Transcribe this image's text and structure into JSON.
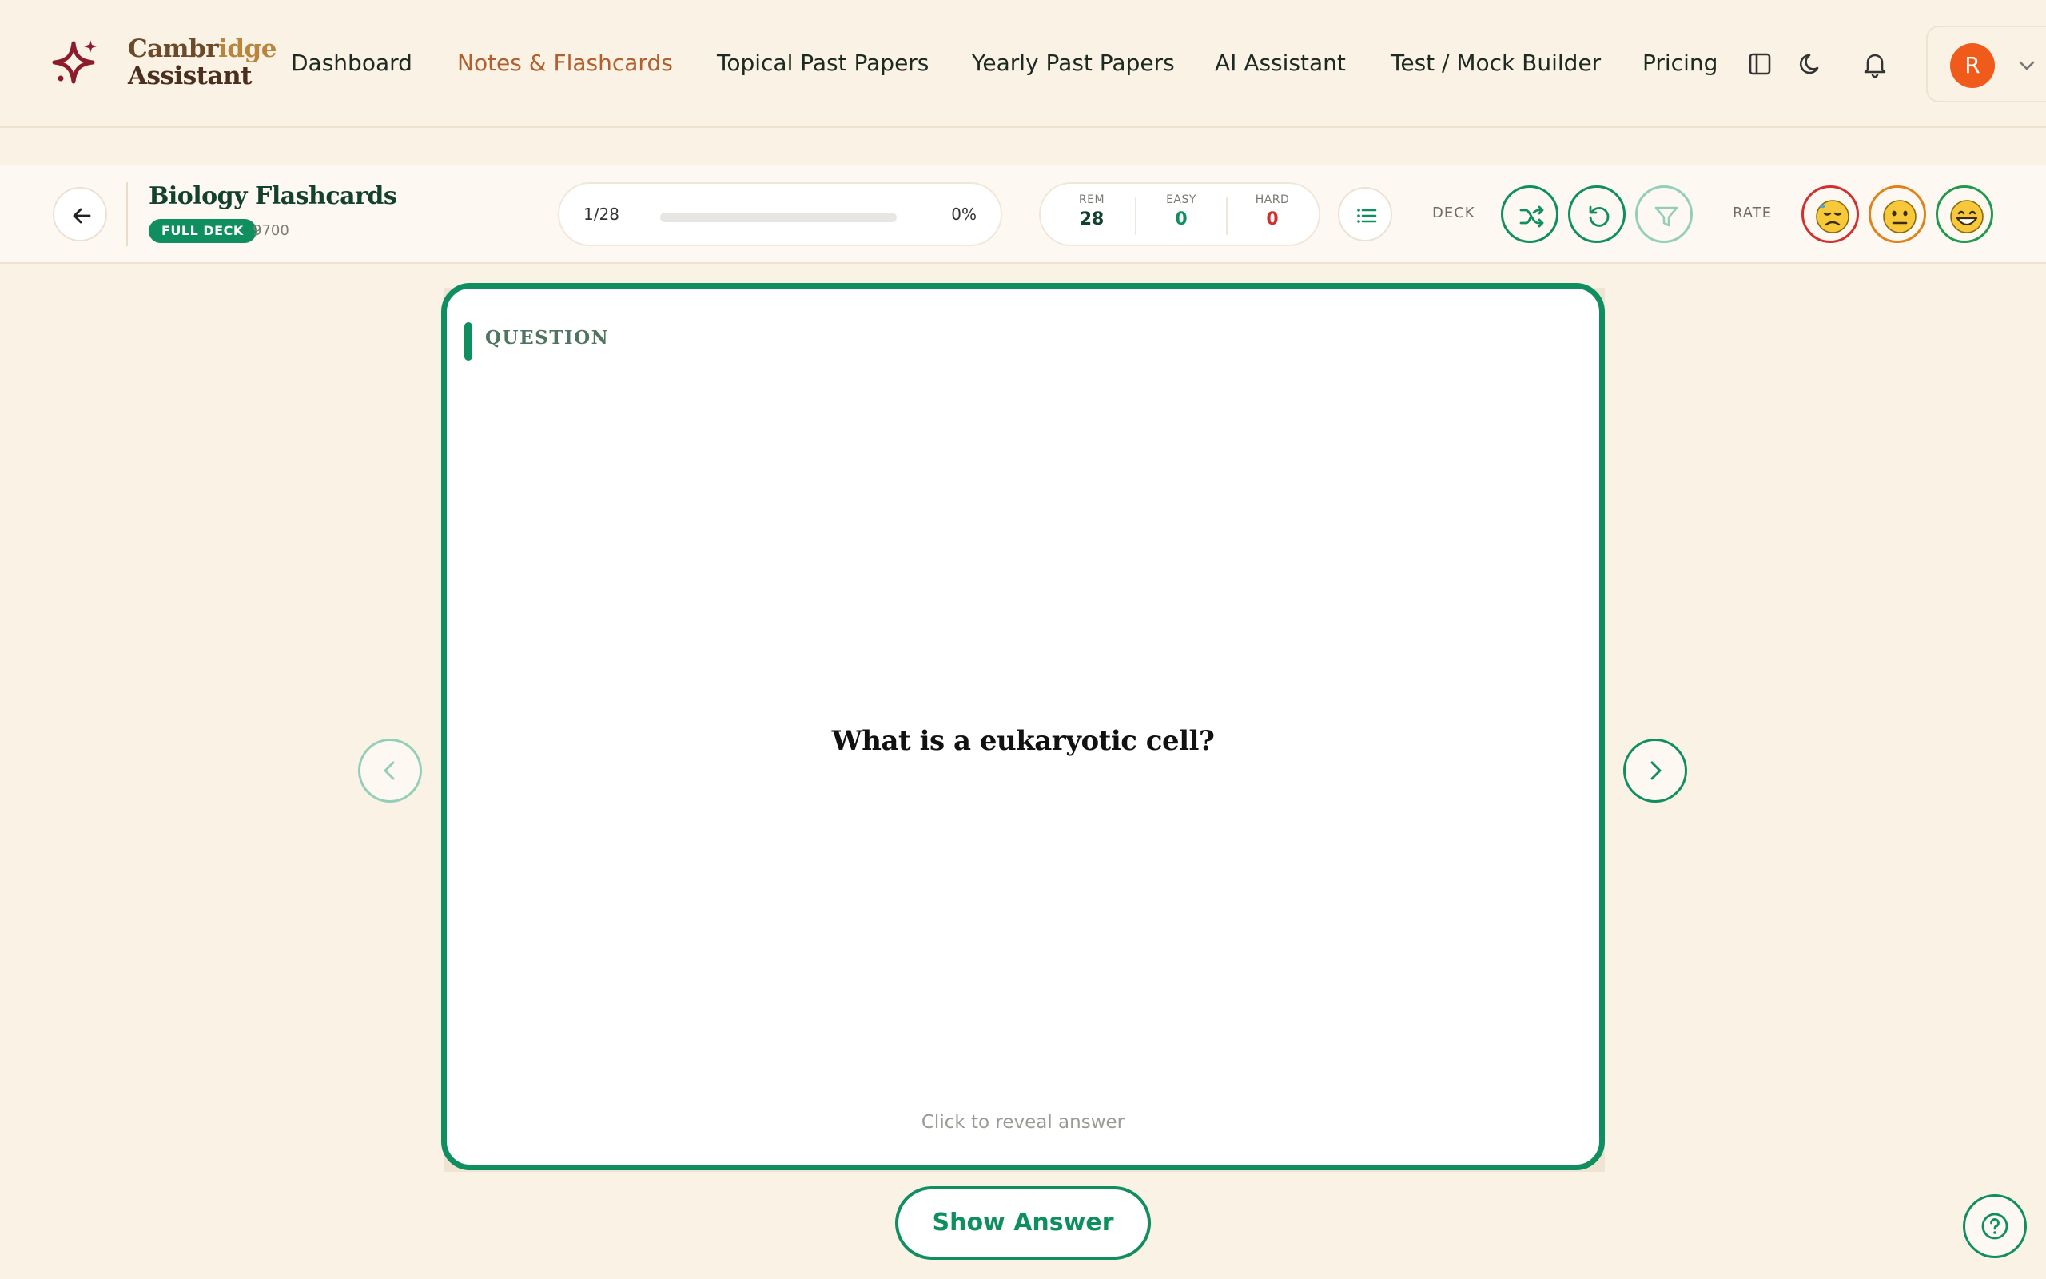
{
  "brand": {
    "line1_a": "Cambr",
    "line1_b": "idge",
    "line2": "Assistant"
  },
  "nav": {
    "items": [
      {
        "label": "Dashboard",
        "active": false
      },
      {
        "label": "Notes & Flashcards",
        "active": true
      },
      {
        "label": "Topical Past Papers",
        "active": false
      },
      {
        "label": "Yearly Past Papers",
        "active": false
      },
      {
        "label": "AI Assistant",
        "active": false
      },
      {
        "label": "Test / Mock Builder",
        "active": false
      },
      {
        "label": "Pricing",
        "active": false
      }
    ],
    "icons": [
      "sidebar-toggle-icon",
      "moon-icon",
      "bell-icon"
    ],
    "user_initial": "R"
  },
  "toolbar": {
    "deck_title": "Biology Flashcards",
    "badge": "FULL DECK",
    "code": "9700",
    "progress": {
      "count": "1/28",
      "percent_label": "0%",
      "fraction": 0.0
    },
    "stats": [
      {
        "label": "REM",
        "value": "28",
        "color": "#13412d"
      },
      {
        "label": "EASY",
        "value": "0",
        "color": "#0f8f5f"
      },
      {
        "label": "HARD",
        "value": "0",
        "color": "#d0302f"
      }
    ],
    "deck_label": "DECK",
    "rate_label": "RATE",
    "deck_actions": [
      "shuffle-icon",
      "reset-icon",
      "filter-icon"
    ],
    "rate_options": [
      "hard",
      "ok",
      "easy"
    ]
  },
  "card": {
    "side_label": "QUESTION",
    "question": "What is a eukaryotic cell?",
    "hint": "Click to reveal answer"
  },
  "show_answer_label": "Show Answer",
  "colors": {
    "accent": "#0f8f5f",
    "background": "#fbf2e6",
    "active_nav": "#b25f2e",
    "hard": "#d0302f",
    "ok": "#e0821a",
    "easy": "#1f9a4d"
  }
}
